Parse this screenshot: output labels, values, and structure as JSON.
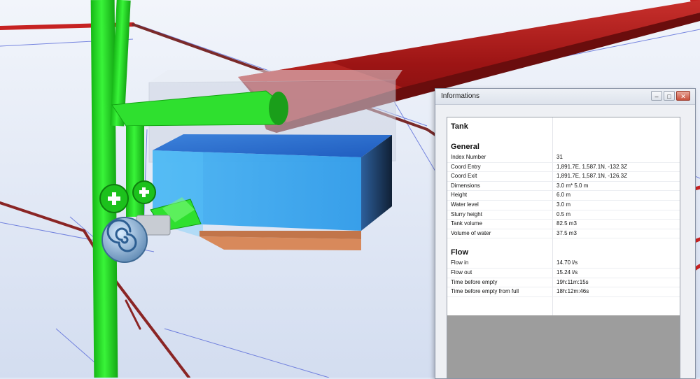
{
  "window": {
    "title": "Informations",
    "buttons": {
      "minimize": "–",
      "maximize": "□",
      "close": "✕"
    }
  },
  "tank": {
    "heading": "Tank",
    "general": {
      "heading": "General",
      "rows": [
        {
          "label": "Index Number",
          "value": "31"
        },
        {
          "label": "Coord Entry",
          "value": "1,891.7E, 1,587.1N, -132.3Z"
        },
        {
          "label": "Coord Exit",
          "value": "1,891.7E, 1,587.1N, -126.3Z"
        },
        {
          "label": "Dimensions",
          "value": "3.0 m* 5.0 m"
        },
        {
          "label": "Height",
          "value": "6.0 m"
        },
        {
          "label": "Water level",
          "value": "3.0 m"
        },
        {
          "label": "Slurry height",
          "value": "0.5 m"
        },
        {
          "label": "Tank volume",
          "value": "82.5 m3"
        },
        {
          "label": "Volume of water",
          "value": "37.5 m3"
        }
      ]
    },
    "flow": {
      "heading": "Flow",
      "rows": [
        {
          "label": "Flow in",
          "value": "14.70 l/s"
        },
        {
          "label": "Flow out",
          "value": "15.24 l/s"
        },
        {
          "label": "Time before empty",
          "value": "19h:11m:15s"
        },
        {
          "label": "Time before empty from full",
          "value": "18h:12m:46s"
        }
      ]
    }
  },
  "colors": {
    "pipe_green": "#22e022",
    "pipe_red": "#a51b1b",
    "water_blue": "#2a8ee0",
    "sediment": "#d98a5a",
    "ground": "#dfe7f5"
  },
  "icons": [
    "add-icon",
    "pump-icon"
  ]
}
